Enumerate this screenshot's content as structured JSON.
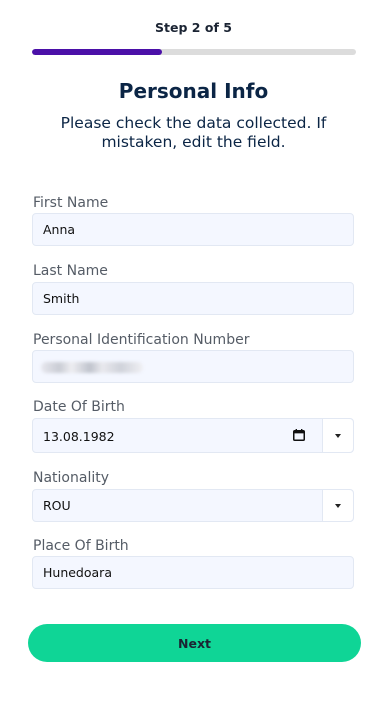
{
  "header": {
    "step_label": "Step 2 of 5",
    "progress_fraction": 0.4,
    "progress_color": "#4b10a8"
  },
  "content": {
    "title": "Personal Info",
    "subtitle": "Please check the data collected. If mistaken, edit the field."
  },
  "form": {
    "first_name": {
      "label": "First Name",
      "value": "Anna"
    },
    "last_name": {
      "label": "Last Name",
      "value": "Smith"
    },
    "personal_id": {
      "label": "Personal Identification Number"
    },
    "date_of_birth": {
      "label": "Date Of Birth",
      "value": "13.08.1982",
      "icon": "calendar-icon"
    },
    "nationality": {
      "label": "Nationality",
      "value": "ROU"
    },
    "place_of_birth": {
      "label": "Place Of Birth",
      "value": "Hunedoara"
    }
  },
  "actions": {
    "next_label": "Next",
    "next_color": "#0fd596"
  }
}
